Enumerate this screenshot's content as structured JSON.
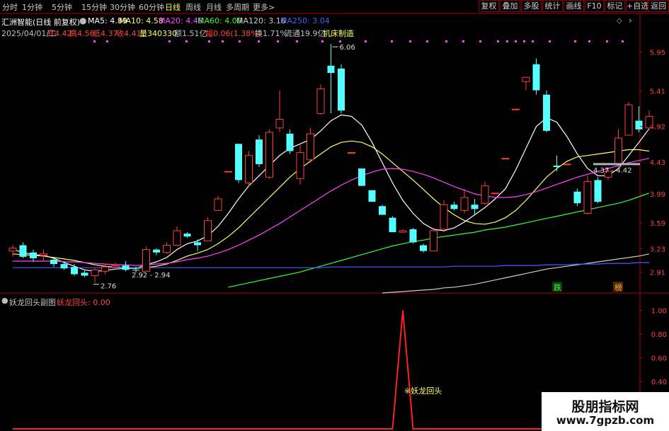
{
  "toolbar": {
    "periods": [
      "分时",
      "1分钟",
      "5分钟",
      "15分钟",
      "30分钟",
      "60分钟",
      "日线",
      "周线",
      "月线",
      "多周期",
      "更多>"
    ],
    "active_period": "日线",
    "buttons": [
      "复权",
      "叠加",
      "多股",
      "统计",
      "画线",
      "F10",
      "标记",
      "+自选",
      "返回"
    ]
  },
  "header": {
    "title": "汇洲智能(日线 前复权)",
    "ma_labels": [
      {
        "text": "MA5: 4.89",
        "color": "#ffffff"
      },
      {
        "text": "MA10: 4.58",
        "color": "#ffff66"
      },
      {
        "text": "MA20: 4.48",
        "color": "#ff44ff"
      },
      {
        "text": "MA60: 4.00",
        "color": "#33ff33"
      },
      {
        "text": "MA120: 3.16",
        "color": "#cccccc"
      },
      {
        "text": "MA250: 3.04",
        "color": "#4060ff"
      }
    ],
    "quote_items": [
      {
        "text": "2025/04/01/二",
        "color": "#c0c0c0"
      },
      {
        "text": "开4.42",
        "color": "#ff4040"
      },
      {
        "text": "高4.56",
        "color": "#ff4040"
      },
      {
        "text": "低4.37",
        "color": "#ff4040"
      },
      {
        "text": "收4.41",
        "color": "#ff4040"
      },
      {
        "text": "量340330",
        "color": "#ffff66"
      },
      {
        "text": "额1.51亿",
        "color": "#c0c0c0"
      },
      {
        "text": "幅0.06(1.38%)",
        "color": "#ff4040"
      },
      {
        "text": "换1.71%",
        "color": "#c0c0c0"
      },
      {
        "text": "流通19.9亿",
        "color": "#c0c0c0"
      },
      {
        "text": "机床制造",
        "color": "#ffff66"
      }
    ]
  },
  "sub_header": {
    "title": "妖龙回头副图",
    "indicator": "妖龙回头: 0.00"
  },
  "colors": {
    "up": "#ff3b3b",
    "down": "#54ffff",
    "frame": "#b00000",
    "ma5": "#ffffff",
    "ma10": "#ffff66",
    "ma20": "#ff44ff",
    "ma60": "#33ff33",
    "ma120": "#cccccc",
    "ma250": "#4060ff"
  },
  "chart_data": [
    {
      "type": "candlestick",
      "ylim": [
        2.62,
        6.12
      ],
      "y_ticks": [
        "5.95",
        "5.41",
        "4.92",
        "4.43",
        "3.99",
        "3.59",
        "3.23",
        "2.91"
      ],
      "annotations": [
        "6.06",
        "4.37 - 4.42",
        "2.92 - 2.94",
        "2.76"
      ],
      "badges": [
        "跌",
        "榜"
      ],
      "candles": [
        {
          "o": 3.2,
          "h": 3.28,
          "l": 3.12,
          "c": 3.24
        },
        {
          "o": 3.28,
          "h": 3.32,
          "l": 3.1,
          "c": 3.12
        },
        {
          "o": 3.18,
          "h": 3.22,
          "l": 3.05,
          "c": 3.1
        },
        {
          "o": 3.14,
          "h": 3.22,
          "l": 3.06,
          "c": 3.16
        },
        {
          "o": 3.08,
          "h": 3.1,
          "l": 2.98,
          "c": 3.02
        },
        {
          "o": 3.02,
          "h": 3.06,
          "l": 2.94,
          "c": 2.96
        },
        {
          "o": 2.98,
          "h": 3.02,
          "l": 2.86,
          "c": 2.88
        },
        {
          "o": 2.9,
          "h": 2.93,
          "l": 2.84,
          "c": 2.86
        },
        {
          "o": 2.86,
          "h": 2.96,
          "l": 2.76,
          "c": 2.94
        },
        {
          "o": 2.92,
          "h": 3.02,
          "l": 2.88,
          "c": 2.98
        },
        {
          "o": 2.98,
          "h": 3.04,
          "l": 2.94,
          "c": 3.0
        },
        {
          "o": 3.0,
          "h": 3.06,
          "l": 2.92,
          "c": 2.94
        },
        {
          "o": 2.94,
          "h": 2.98,
          "l": 2.9,
          "c": 2.93
        },
        {
          "o": 2.92,
          "h": 3.26,
          "l": 2.92,
          "c": 3.22
        },
        {
          "o": 3.22,
          "h": 3.24,
          "l": 3.14,
          "c": 3.18
        },
        {
          "o": 3.18,
          "h": 3.32,
          "l": 3.16,
          "c": 3.28
        },
        {
          "o": 3.28,
          "h": 3.54,
          "l": 3.28,
          "c": 3.48
        },
        {
          "o": 3.44,
          "h": 3.46,
          "l": 3.38,
          "c": 3.4
        },
        {
          "o": 3.32,
          "h": 3.36,
          "l": 3.2,
          "c": 3.28
        },
        {
          "o": 3.34,
          "h": 3.66,
          "l": 3.34,
          "c": 3.62
        },
        {
          "o": 3.76,
          "h": 3.96,
          "l": 3.76,
          "c": 3.92
        },
        {
          "o": 4.3,
          "h": 4.3,
          "l": 4.3,
          "c": 4.3
        },
        {
          "o": 4.68,
          "h": 4.68,
          "l": 4.14,
          "c": 4.18
        },
        {
          "o": 4.14,
          "h": 4.58,
          "l": 4.1,
          "c": 4.52
        },
        {
          "o": 4.74,
          "h": 4.8,
          "l": 4.36,
          "c": 4.4
        },
        {
          "o": 4.22,
          "h": 4.88,
          "l": 4.2,
          "c": 4.84
        },
        {
          "o": 4.9,
          "h": 5.42,
          "l": 4.84,
          "c": 5.02
        },
        {
          "o": 4.82,
          "h": 4.88,
          "l": 4.54,
          "c": 4.58
        },
        {
          "o": 4.2,
          "h": 4.68,
          "l": 4.12,
          "c": 4.56
        },
        {
          "o": 4.46,
          "h": 4.9,
          "l": 4.42,
          "c": 4.82
        },
        {
          "o": 5.1,
          "h": 5.5,
          "l": 5.08,
          "c": 5.44
        },
        {
          "o": 5.76,
          "h": 6.06,
          "l": 5.1,
          "c": 5.66
        },
        {
          "o": 5.72,
          "h": 5.78,
          "l": 5.1,
          "c": 5.14
        },
        {
          "o": 4.56,
          "h": 4.56,
          "l": 4.56,
          "c": 4.56
        },
        {
          "o": 4.34,
          "h": 4.34,
          "l": 4.1,
          "c": 4.1
        },
        {
          "o": 4.04,
          "h": 4.04,
          "l": 3.9,
          "c": 3.88
        },
        {
          "o": 3.82,
          "h": 3.84,
          "l": 3.7,
          "c": 3.7
        },
        {
          "o": 3.66,
          "h": 3.68,
          "l": 3.46,
          "c": 3.46
        },
        {
          "o": 3.46,
          "h": 3.5,
          "l": 3.46,
          "c": 3.48
        },
        {
          "o": 3.5,
          "h": 3.52,
          "l": 3.3,
          "c": 3.32
        },
        {
          "o": 3.28,
          "h": 3.3,
          "l": 3.18,
          "c": 3.2
        },
        {
          "o": 3.2,
          "h": 3.52,
          "l": 3.2,
          "c": 3.48
        },
        {
          "o": 3.5,
          "h": 3.9,
          "l": 3.46,
          "c": 3.84
        },
        {
          "o": 3.84,
          "h": 3.88,
          "l": 3.76,
          "c": 3.78
        },
        {
          "o": 3.76,
          "h": 4.06,
          "l": 3.72,
          "c": 3.94
        },
        {
          "o": 3.84,
          "h": 3.92,
          "l": 3.7,
          "c": 3.78
        },
        {
          "o": 3.86,
          "h": 4.16,
          "l": 3.84,
          "c": 4.1
        },
        {
          "o": 4.0,
          "h": 4.0,
          "l": 4.0,
          "c": 4.0
        },
        {
          "o": 4.48,
          "h": 4.48,
          "l": 4.48,
          "c": 4.48
        },
        {
          "o": 5.16,
          "h": 5.16,
          "l": 5.16,
          "c": 5.16
        },
        {
          "o": 5.54,
          "h": 5.6,
          "l": 5.42,
          "c": 5.6
        },
        {
          "o": 5.78,
          "h": 5.86,
          "l": 5.36,
          "c": 5.42
        },
        {
          "o": 5.36,
          "h": 5.42,
          "l": 4.84,
          "c": 4.86
        },
        {
          "o": 4.38,
          "h": 4.52,
          "l": 4.3,
          "c": 4.36
        },
        {
          "o": 4.4,
          "h": 4.4,
          "l": 4.4,
          "c": 4.4
        },
        {
          "o": 4.02,
          "h": 4.06,
          "l": 3.82,
          "c": 3.86
        },
        {
          "o": 3.72,
          "h": 4.24,
          "l": 3.7,
          "c": 4.16
        },
        {
          "o": 4.18,
          "h": 4.22,
          "l": 3.86,
          "c": 3.88
        },
        {
          "o": 4.22,
          "h": 4.36,
          "l": 4.18,
          "c": 4.3
        },
        {
          "o": 4.4,
          "h": 4.88,
          "l": 4.36,
          "c": 4.76
        },
        {
          "o": 4.8,
          "h": 5.26,
          "l": 4.8,
          "c": 5.22
        },
        {
          "o": 5.0,
          "h": 5.2,
          "l": 4.84,
          "c": 4.88
        },
        {
          "o": 4.9,
          "h": 5.14,
          "l": 4.88,
          "c": 5.06
        }
      ],
      "ma_lines": [
        {
          "name": "MA5",
          "values": [
            3.22,
            3.18,
            3.15,
            3.14,
            3.1,
            3.04,
            2.99,
            2.94,
            2.92,
            2.93,
            2.95,
            2.96,
            2.96,
            3.01,
            3.05,
            3.11,
            3.22,
            3.3,
            3.34,
            3.41,
            3.54,
            3.72,
            3.92,
            4.1,
            4.24,
            4.38,
            4.52,
            4.62,
            4.68,
            4.74,
            4.86,
            5.0,
            5.08,
            5.06,
            4.94,
            4.7,
            4.42,
            4.14,
            3.9,
            3.72,
            3.58,
            3.5,
            3.48,
            3.52,
            3.6,
            3.7,
            3.8,
            3.92,
            4.06,
            4.32,
            4.62,
            4.92,
            5.04,
            4.98,
            4.78,
            4.54,
            4.34,
            4.24,
            4.24,
            4.34,
            4.52,
            4.7,
            4.89
          ]
        },
        {
          "name": "MA10",
          "values": [
            3.16,
            3.15,
            3.14,
            3.13,
            3.11,
            3.09,
            3.07,
            3.04,
            3.01,
            2.99,
            2.98,
            2.97,
            2.96,
            2.97,
            2.99,
            3.02,
            3.07,
            3.13,
            3.17,
            3.22,
            3.3,
            3.4,
            3.52,
            3.66,
            3.8,
            3.94,
            4.08,
            4.22,
            4.34,
            4.44,
            4.54,
            4.64,
            4.7,
            4.72,
            4.7,
            4.64,
            4.54,
            4.42,
            4.3,
            4.18,
            4.05,
            3.92,
            3.8,
            3.7,
            3.62,
            3.58,
            3.57,
            3.6,
            3.66,
            3.76,
            3.9,
            4.06,
            4.22,
            4.34,
            4.44,
            4.5,
            4.52,
            4.54,
            4.56,
            4.58,
            4.6,
            4.6,
            4.58
          ]
        },
        {
          "name": "MA20",
          "values": [
            3.06,
            3.06,
            3.06,
            3.06,
            3.06,
            3.05,
            3.05,
            3.04,
            3.03,
            3.02,
            3.01,
            3.01,
            3.0,
            3.01,
            3.02,
            3.03,
            3.05,
            3.08,
            3.1,
            3.13,
            3.17,
            3.22,
            3.28,
            3.35,
            3.42,
            3.5,
            3.58,
            3.67,
            3.76,
            3.85,
            3.94,
            4.03,
            4.11,
            4.18,
            4.24,
            4.29,
            4.33,
            4.34,
            4.33,
            4.3,
            4.26,
            4.21,
            4.15,
            4.09,
            4.04,
            3.99,
            3.96,
            3.94,
            3.94,
            3.95,
            3.98,
            4.02,
            4.07,
            4.12,
            4.17,
            4.22,
            4.26,
            4.3,
            4.34,
            4.38,
            4.42,
            4.45,
            4.48
          ]
        },
        {
          "name": "MA60",
          "values": [
            null,
            null,
            null,
            null,
            null,
            null,
            null,
            null,
            null,
            null,
            null,
            null,
            null,
            null,
            null,
            null,
            null,
            null,
            null,
            null,
            null,
            2.7,
            2.73,
            2.76,
            2.79,
            2.82,
            2.85,
            2.88,
            2.91,
            2.95,
            2.99,
            3.03,
            3.07,
            3.11,
            3.15,
            3.19,
            3.23,
            3.27,
            3.3,
            3.33,
            3.35,
            3.38,
            3.4,
            3.42,
            3.44,
            3.46,
            3.49,
            3.51,
            3.53,
            3.56,
            3.59,
            3.62,
            3.65,
            3.68,
            3.71,
            3.74,
            3.77,
            3.8,
            3.83,
            3.86,
            3.9,
            3.95,
            4.0
          ]
        },
        {
          "name": "MA120",
          "values": [
            null,
            null,
            null,
            null,
            null,
            null,
            null,
            null,
            null,
            null,
            null,
            null,
            null,
            null,
            null,
            null,
            null,
            null,
            null,
            null,
            null,
            null,
            null,
            null,
            null,
            null,
            null,
            null,
            null,
            null,
            null,
            null,
            null,
            null,
            null,
            null,
            2.62,
            2.63,
            2.64,
            2.65,
            2.66,
            2.67,
            2.69,
            2.7,
            2.72,
            2.74,
            2.77,
            2.8,
            2.83,
            2.86,
            2.89,
            2.92,
            2.95,
            2.97,
            2.99,
            3.01,
            3.03,
            3.05,
            3.07,
            3.09,
            3.11,
            3.13,
            3.16
          ]
        },
        {
          "name": "MA250",
          "values": [
            2.97,
            2.97,
            2.97,
            2.97,
            2.97,
            2.97,
            2.97,
            2.97,
            2.97,
            2.97,
            2.97,
            2.97,
            2.97,
            2.97,
            2.97,
            2.97,
            2.97,
            2.97,
            2.97,
            2.97,
            2.97,
            2.97,
            2.97,
            2.97,
            2.97,
            2.97,
            2.97,
            2.97,
            2.97,
            2.97,
            2.97,
            2.98,
            2.98,
            2.98,
            2.98,
            2.98,
            2.98,
            2.98,
            2.98,
            2.98,
            2.98,
            2.98,
            2.98,
            2.99,
            2.99,
            2.99,
            2.99,
            2.99,
            3.0,
            3.0,
            3.0,
            3.0,
            3.01,
            3.01,
            3.01,
            3.02,
            3.02,
            3.02,
            3.03,
            3.03,
            3.03,
            3.04,
            3.04
          ]
        }
      ]
    },
    {
      "type": "line",
      "name": "妖龙回头",
      "ylim": [
        0,
        1.1
      ],
      "y_ticks": [
        "1.00",
        "0.80",
        "0.60",
        "0.40"
      ],
      "signal_label": "※妖龙回头",
      "values": [
        0,
        0,
        0,
        0,
        0,
        0,
        0,
        0,
        0,
        0,
        0,
        0,
        0,
        0,
        0,
        0,
        0,
        0,
        0,
        0,
        0,
        0,
        0,
        0,
        0,
        0,
        0,
        0,
        0,
        0,
        0,
        0,
        0,
        0,
        0,
        0,
        0,
        0,
        1,
        0,
        0,
        0,
        0,
        0,
        0,
        0,
        0,
        0,
        0,
        0,
        0,
        0,
        0,
        0,
        0,
        0,
        0,
        0,
        0,
        0,
        0,
        0,
        0
      ]
    }
  ],
  "watermark": {
    "line1": "股朋指标网",
    "line2": "www.7gpzb.com"
  }
}
